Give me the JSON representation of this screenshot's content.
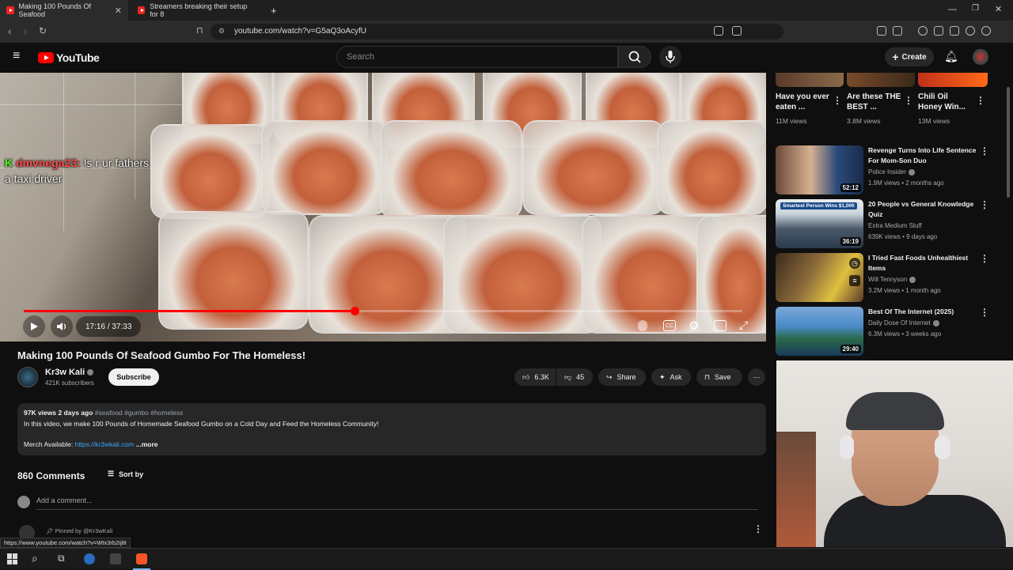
{
  "browser": {
    "tabs": [
      {
        "title": "Making 100 Pounds Of Seafood"
      },
      {
        "title": "Streamers breaking their setup for 8"
      }
    ],
    "url": "youtube.com/watch?v=G5aQ3oAcyfU",
    "status_url": "https://www.youtube.com/watch?v=Wtx3rb2ij8I"
  },
  "youtube": {
    "logo_text": "YouTube",
    "search_placeholder": "Search",
    "create_label": "Create"
  },
  "player": {
    "chat_badge": "K",
    "chat_user": "dmvnega23:",
    "chat_message_1": "!s r ur fathers",
    "chat_message_2": "a taxi driver",
    "time_display": "17:16 / 37:33",
    "progress_fraction": 0.46
  },
  "video": {
    "title": "Making 100 Pounds Of Seafood Gumbo For The Homeless!",
    "channel": "Kr3w Kali",
    "subscribers": "421K subscribers",
    "subscribe_label": "Subscribe",
    "likes": "6.3K",
    "dislikes": "45",
    "share_label": "Share",
    "ask_label": "Ask",
    "save_label": "Save",
    "views_date": "97K views  2 days ago",
    "tags": "#seafood #gumbo #homeless",
    "description": "In this video, we make 100 Pounds of Homemade Seafood Gumbo on a Cold Day and Feed the Homeless Community!",
    "merch_label": "Merch Available:",
    "merch_link": "https://kr3wkali.com",
    "more_label": "...more"
  },
  "comments": {
    "count_label": "860 Comments",
    "sort_label": "Sort by",
    "add_placeholder": "Add a comment...",
    "pinned_label": "Pinned by @Kr3wKali"
  },
  "shorts": [
    {
      "title": "Have you ever eaten ...",
      "views": "11M views"
    },
    {
      "title": "Are these THE BEST ...",
      "views": "3.8M views"
    },
    {
      "title": "Chili Oil Honey Win...",
      "views": "13M views"
    }
  ],
  "recommendations": [
    {
      "title": "Revenge Turns Into Life Sentence For Mom-Son Duo",
      "channel": "Police Insider",
      "meta": "1.9M views • 2 months ago",
      "duration": "52:12",
      "verified": true
    },
    {
      "title": "20 People vs General Knowledge Quiz",
      "channel": "Extra Medium Stuff",
      "meta": "639K views • 9 days ago",
      "duration": "36:19",
      "verified": false,
      "thumb_caption": "Smartest Person Wins $1,000"
    },
    {
      "title": "I Tried Fast Foods Unhealthiest Items",
      "channel": "Will Tennyson",
      "meta": "3.2M views • 1 month ago",
      "duration": "",
      "verified": true
    },
    {
      "title": "Best Of The Internet (2025)",
      "channel": "Daily Dose Of Internet",
      "meta": "6.3M views • 3 weeks ago",
      "duration": "29:40",
      "verified": true
    }
  ],
  "colors": {
    "accent": "#ff0000",
    "background": "#0f0f0f",
    "link": "#3ea6ff"
  }
}
